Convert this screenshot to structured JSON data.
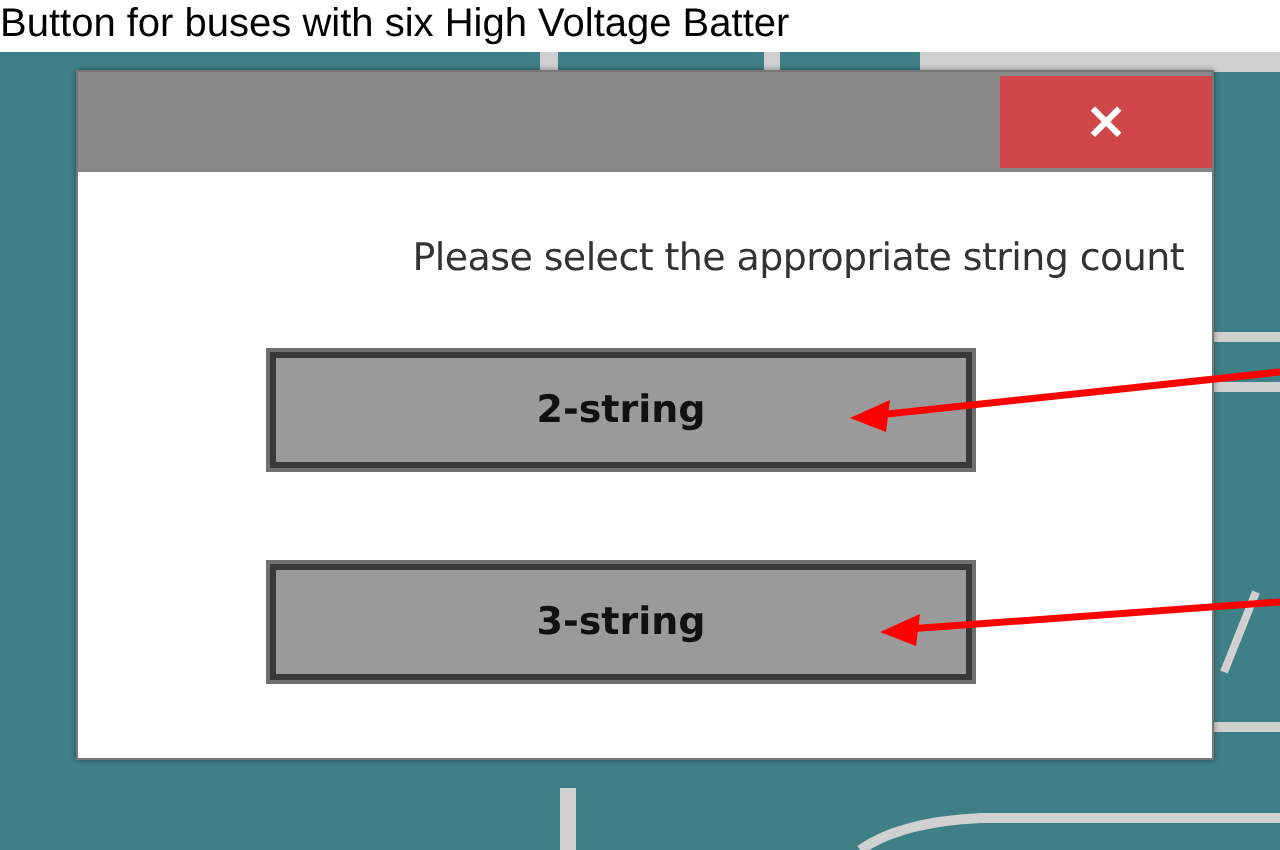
{
  "caption": "Button for buses with six High Voltage Batter",
  "dialog": {
    "close_label": "×",
    "message": "Please select the appropriate string count",
    "buttons": [
      "2-string",
      "3-string"
    ]
  }
}
